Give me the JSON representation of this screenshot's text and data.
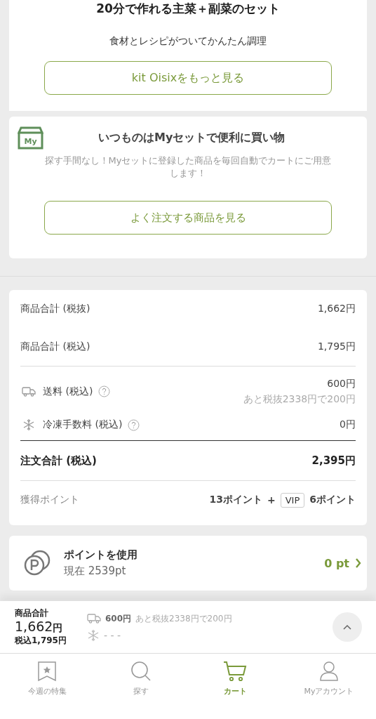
{
  "kit_card": {
    "title": "20分で作れる主菜＋副菜のセット",
    "subtitle": "食材とレシピがついてかんたん調理",
    "button": "kit Oisixをもっと見る"
  },
  "myset_card": {
    "icon_label": "My",
    "title": "いつものはMyセットで便利に買い物",
    "description": "探す手間なし！Myセットに登録した商品を毎回自動でカートにご用意します！",
    "button": "よく注文する商品を見る"
  },
  "summary": {
    "rows": [
      {
        "kind": "subtotal",
        "label": "商品合計 (税抜)",
        "value": "1,662円"
      },
      {
        "kind": "subtotal",
        "label": "商品合計 (税込)",
        "value": "1,795円"
      },
      {
        "kind": "shipping",
        "label": "送料 (税込)",
        "value": "600円",
        "note": "あと税抜2338円で200円"
      },
      {
        "kind": "frozen",
        "label": "冷凍手数料 (税込)",
        "value": "0円"
      },
      {
        "kind": "total",
        "label": "注文合計 (税込)",
        "value": "2,395円"
      }
    ],
    "points": {
      "label": "獲得ポイント",
      "earned": "13ポイント",
      "plus": "+",
      "badge": "VIP",
      "bonus": "6ポイント"
    }
  },
  "points_card": {
    "title": "ポイントを使用",
    "current": "現在 2539pt",
    "value": "0 pt"
  },
  "cart_bar": {
    "label": "商品合計",
    "amount": "1,662",
    "unit": "円",
    "tax_included": "税込1,795円",
    "shipping_value": "600円",
    "shipping_note": "あと税抜2338円で200円",
    "frozen_value": "- - -"
  },
  "tabs": [
    {
      "kind": "featured",
      "label": "今週の特集",
      "selected": false
    },
    {
      "kind": "search",
      "label": "探す",
      "selected": false
    },
    {
      "kind": "cart",
      "label": "カート",
      "selected": true
    },
    {
      "kind": "account",
      "label": "Myアカウント",
      "selected": false
    }
  ]
}
